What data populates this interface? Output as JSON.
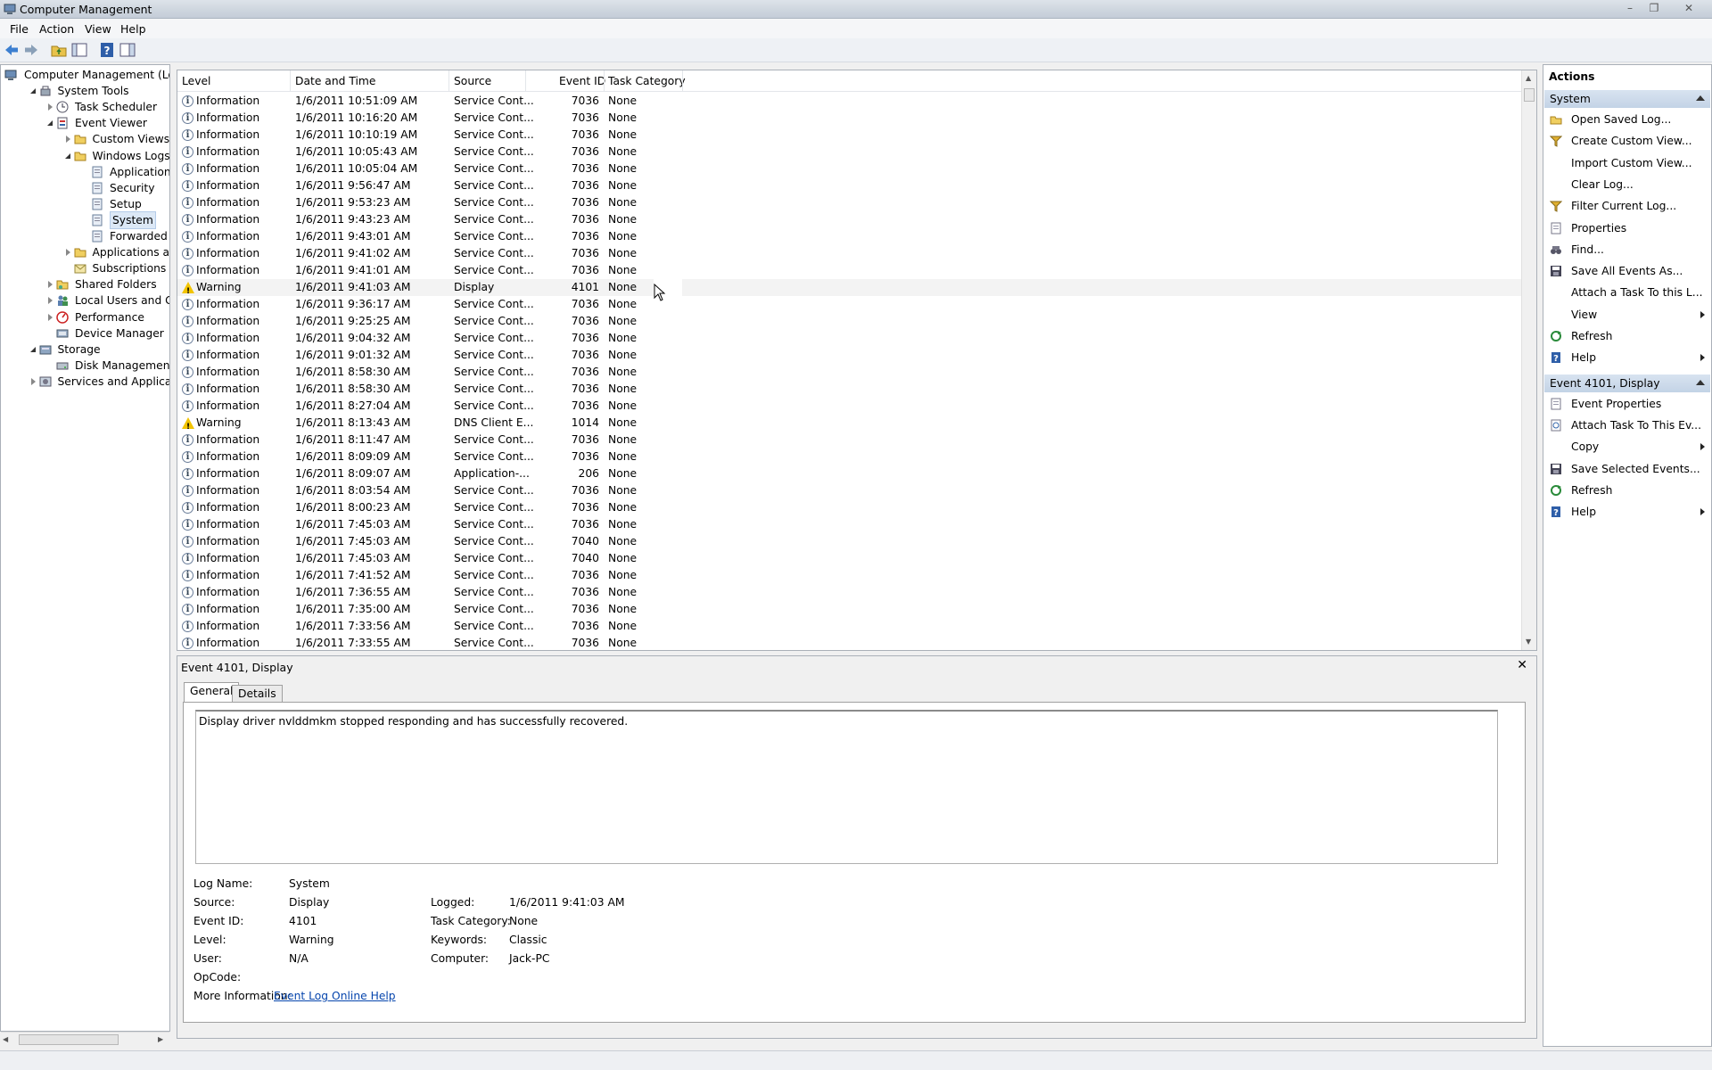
{
  "window": {
    "title": "Computer Management"
  },
  "menu": [
    "File",
    "Action",
    "View",
    "Help"
  ],
  "tree": [
    {
      "label": "Computer Management (Local",
      "level": 0,
      "exp": "",
      "icon": "computer-icon"
    },
    {
      "label": "System Tools",
      "level": 1,
      "exp": "open",
      "icon": "tools-icon"
    },
    {
      "label": "Task Scheduler",
      "level": 2,
      "exp": "closed",
      "icon": "clock-icon"
    },
    {
      "label": "Event Viewer",
      "level": 2,
      "exp": "open",
      "icon": "event-viewer-icon"
    },
    {
      "label": "Custom Views",
      "level": 3,
      "exp": "closed",
      "icon": "folder-icon"
    },
    {
      "label": "Windows Logs",
      "level": 3,
      "exp": "open",
      "icon": "folder-icon"
    },
    {
      "label": "Application",
      "level": 4,
      "exp": "",
      "icon": "log-icon"
    },
    {
      "label": "Security",
      "level": 4,
      "exp": "",
      "icon": "log-icon"
    },
    {
      "label": "Setup",
      "level": 4,
      "exp": "",
      "icon": "log-icon"
    },
    {
      "label": "System",
      "level": 4,
      "exp": "",
      "icon": "log-icon",
      "selected": true
    },
    {
      "label": "Forwarded Event",
      "level": 4,
      "exp": "",
      "icon": "log-icon"
    },
    {
      "label": "Applications and Se",
      "level": 3,
      "exp": "closed",
      "icon": "folder-icon"
    },
    {
      "label": "Subscriptions",
      "level": 3,
      "exp": "",
      "icon": "subscriptions-icon"
    },
    {
      "label": "Shared Folders",
      "level": 2,
      "exp": "closed",
      "icon": "shared-folder-icon"
    },
    {
      "label": "Local Users and Groups",
      "level": 2,
      "exp": "closed",
      "icon": "users-icon"
    },
    {
      "label": "Performance",
      "level": 2,
      "exp": "closed",
      "icon": "performance-icon"
    },
    {
      "label": "Device Manager",
      "level": 2,
      "exp": "",
      "icon": "device-manager-icon"
    },
    {
      "label": "Storage",
      "level": 1,
      "exp": "open",
      "icon": "storage-icon"
    },
    {
      "label": "Disk Management",
      "level": 2,
      "exp": "",
      "icon": "disk-icon"
    },
    {
      "label": "Services and Applications",
      "level": 1,
      "exp": "closed",
      "icon": "services-icon"
    }
  ],
  "grid": {
    "columns": [
      "Level",
      "Date and Time",
      "Source",
      "Event ID",
      "Task Category"
    ],
    "rows": [
      {
        "level": "Information",
        "date": "1/6/2011 10:51:09 AM",
        "source": "Service Cont...",
        "id": "7036",
        "cat": "None"
      },
      {
        "level": "Information",
        "date": "1/6/2011 10:16:20 AM",
        "source": "Service Cont...",
        "id": "7036",
        "cat": "None"
      },
      {
        "level": "Information",
        "date": "1/6/2011 10:10:19 AM",
        "source": "Service Cont...",
        "id": "7036",
        "cat": "None"
      },
      {
        "level": "Information",
        "date": "1/6/2011 10:05:43 AM",
        "source": "Service Cont...",
        "id": "7036",
        "cat": "None"
      },
      {
        "level": "Information",
        "date": "1/6/2011 10:05:04 AM",
        "source": "Service Cont...",
        "id": "7036",
        "cat": "None"
      },
      {
        "level": "Information",
        "date": "1/6/2011 9:56:47 AM",
        "source": "Service Cont...",
        "id": "7036",
        "cat": "None"
      },
      {
        "level": "Information",
        "date": "1/6/2011 9:53:23 AM",
        "source": "Service Cont...",
        "id": "7036",
        "cat": "None"
      },
      {
        "level": "Information",
        "date": "1/6/2011 9:43:23 AM",
        "source": "Service Cont...",
        "id": "7036",
        "cat": "None"
      },
      {
        "level": "Information",
        "date": "1/6/2011 9:43:01 AM",
        "source": "Service Cont...",
        "id": "7036",
        "cat": "None"
      },
      {
        "level": "Information",
        "date": "1/6/2011 9:41:02 AM",
        "source": "Service Cont...",
        "id": "7036",
        "cat": "None"
      },
      {
        "level": "Information",
        "date": "1/6/2011 9:41:01 AM",
        "source": "Service Cont...",
        "id": "7036",
        "cat": "None"
      },
      {
        "level": "Warning",
        "date": "1/6/2011 9:41:03 AM",
        "source": "Display",
        "id": "4101",
        "cat": "None",
        "selected": true
      },
      {
        "level": "Information",
        "date": "1/6/2011 9:36:17 AM",
        "source": "Service Cont...",
        "id": "7036",
        "cat": "None"
      },
      {
        "level": "Information",
        "date": "1/6/2011 9:25:25 AM",
        "source": "Service Cont...",
        "id": "7036",
        "cat": "None"
      },
      {
        "level": "Information",
        "date": "1/6/2011 9:04:32 AM",
        "source": "Service Cont...",
        "id": "7036",
        "cat": "None"
      },
      {
        "level": "Information",
        "date": "1/6/2011 9:01:32 AM",
        "source": "Service Cont...",
        "id": "7036",
        "cat": "None"
      },
      {
        "level": "Information",
        "date": "1/6/2011 8:58:30 AM",
        "source": "Service Cont...",
        "id": "7036",
        "cat": "None"
      },
      {
        "level": "Information",
        "date": "1/6/2011 8:58:30 AM",
        "source": "Service Cont...",
        "id": "7036",
        "cat": "None"
      },
      {
        "level": "Information",
        "date": "1/6/2011 8:27:04 AM",
        "source": "Service Cont...",
        "id": "7036",
        "cat": "None"
      },
      {
        "level": "Warning",
        "date": "1/6/2011 8:13:43 AM",
        "source": "DNS Client E...",
        "id": "1014",
        "cat": "None"
      },
      {
        "level": "Information",
        "date": "1/6/2011 8:11:47 AM",
        "source": "Service Cont...",
        "id": "7036",
        "cat": "None"
      },
      {
        "level": "Information",
        "date": "1/6/2011 8:09:09 AM",
        "source": "Service Cont...",
        "id": "7036",
        "cat": "None"
      },
      {
        "level": "Information",
        "date": "1/6/2011 8:09:07 AM",
        "source": "Application-...",
        "id": "206",
        "cat": "None"
      },
      {
        "level": "Information",
        "date": "1/6/2011 8:03:54 AM",
        "source": "Service Cont...",
        "id": "7036",
        "cat": "None"
      },
      {
        "level": "Information",
        "date": "1/6/2011 8:00:23 AM",
        "source": "Service Cont...",
        "id": "7036",
        "cat": "None"
      },
      {
        "level": "Information",
        "date": "1/6/2011 7:45:03 AM",
        "source": "Service Cont...",
        "id": "7036",
        "cat": "None"
      },
      {
        "level": "Information",
        "date": "1/6/2011 7:45:03 AM",
        "source": "Service Cont...",
        "id": "7040",
        "cat": "None"
      },
      {
        "level": "Information",
        "date": "1/6/2011 7:45:03 AM",
        "source": "Service Cont...",
        "id": "7040",
        "cat": "None"
      },
      {
        "level": "Information",
        "date": "1/6/2011 7:41:52 AM",
        "source": "Service Cont...",
        "id": "7036",
        "cat": "None"
      },
      {
        "level": "Information",
        "date": "1/6/2011 7:36:55 AM",
        "source": "Service Cont...",
        "id": "7036",
        "cat": "None"
      },
      {
        "level": "Information",
        "date": "1/6/2011 7:35:00 AM",
        "source": "Service Cont...",
        "id": "7036",
        "cat": "None"
      },
      {
        "level": "Information",
        "date": "1/6/2011 7:33:56 AM",
        "source": "Service Cont...",
        "id": "7036",
        "cat": "None"
      },
      {
        "level": "Information",
        "date": "1/6/2011 7:33:55 AM",
        "source": "Service Cont...",
        "id": "7036",
        "cat": "None"
      }
    ]
  },
  "detail": {
    "title": "Event 4101, Display",
    "tabs": [
      "General",
      "Details"
    ],
    "message": "Display driver nvlddmkm stopped responding and has successfully recovered.",
    "fields": {
      "log_name_label": "Log Name:",
      "log_name": "System",
      "source_label": "Source:",
      "source": "Display",
      "logged_label": "Logged:",
      "logged": "1/6/2011 9:41:03 AM",
      "event_id_label": "Event ID:",
      "event_id": "4101",
      "task_cat_label": "Task Category:",
      "task_cat": "None",
      "level_label": "Level:",
      "level": "Warning",
      "keywords_label": "Keywords:",
      "keywords": "Classic",
      "user_label": "User:",
      "user": "N/A",
      "computer_label": "Computer:",
      "computer": "Jack-PC",
      "opcode_label": "OpCode:",
      "opcode": "",
      "more_info_label": "More Information:",
      "more_info_link": "Event Log Online Help"
    }
  },
  "actions": {
    "title": "Actions",
    "sections": [
      {
        "header": "System",
        "items": [
          {
            "label": "Open Saved Log...",
            "icon": "open-folder-icon"
          },
          {
            "label": "Create Custom View...",
            "icon": "filter-icon"
          },
          {
            "label": "Import Custom View...",
            "icon": ""
          },
          {
            "label": "Clear Log...",
            "icon": ""
          },
          {
            "label": "Filter Current Log...",
            "icon": "filter-icon"
          },
          {
            "label": "Properties",
            "icon": "properties-icon"
          },
          {
            "label": "Find...",
            "icon": "binoculars-icon"
          },
          {
            "label": "Save All Events As...",
            "icon": "save-icon"
          },
          {
            "label": "Attach a Task To this L...",
            "icon": ""
          },
          {
            "label": "View",
            "icon": "",
            "submenu": true
          },
          {
            "label": "Refresh",
            "icon": "refresh-icon"
          },
          {
            "label": "Help",
            "icon": "help-icon",
            "submenu": true
          }
        ]
      },
      {
        "header": "Event 4101, Display",
        "items": [
          {
            "label": "Event Properties",
            "icon": "properties-icon"
          },
          {
            "label": "Attach Task To This Ev...",
            "icon": "task-icon"
          },
          {
            "label": "Copy",
            "icon": "",
            "submenu": true
          },
          {
            "label": "Save Selected Events...",
            "icon": "save-icon"
          },
          {
            "label": "Refresh",
            "icon": "refresh-icon"
          },
          {
            "label": "Help",
            "icon": "help-icon",
            "submenu": true
          }
        ]
      }
    ]
  }
}
